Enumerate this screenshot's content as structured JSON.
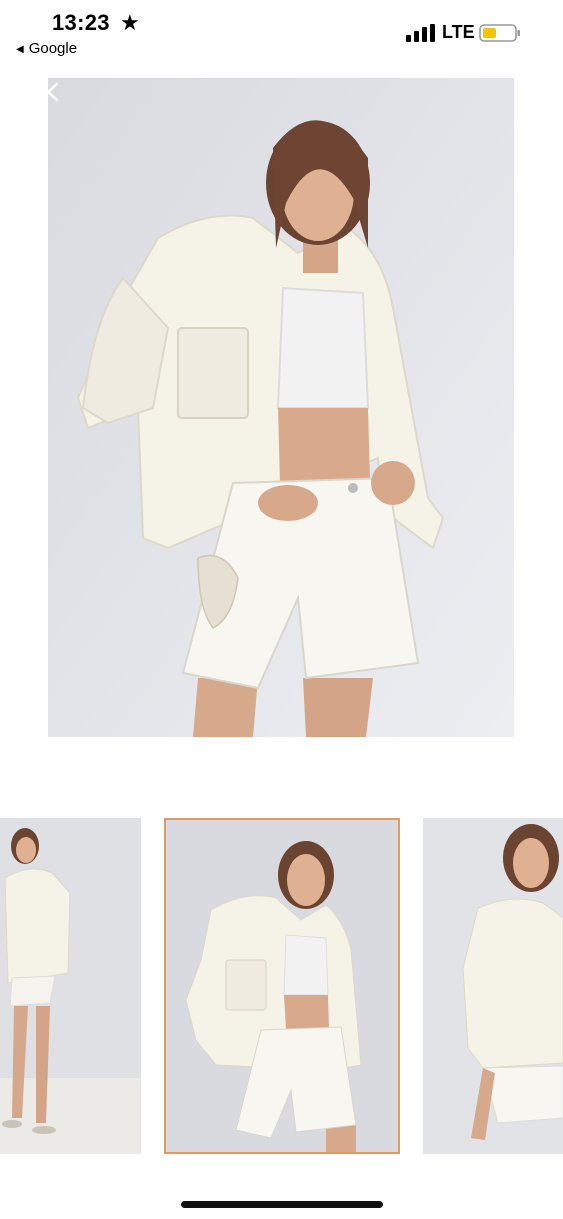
{
  "status_bar": {
    "time": "13:23",
    "back_app_label": "Google",
    "network": "LTE",
    "battery_color": "#f2c500",
    "icons": [
      "star-icon",
      "signal-icon",
      "battery-icon"
    ]
  },
  "gallery": {
    "selected_index": 1,
    "accent_color": "#e29a5e",
    "thumbnail_count": 3
  }
}
